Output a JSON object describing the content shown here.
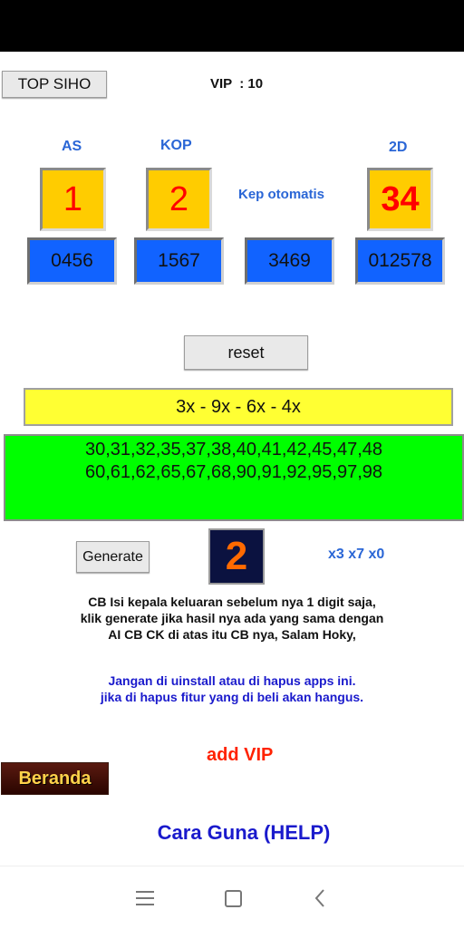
{
  "header": {
    "top_siho_label": "TOP SIHO",
    "vip_text": "VIP  : 10"
  },
  "labels": {
    "as": "AS",
    "kop": "KOP",
    "two_d": "2D",
    "kep": "Kep otomatis"
  },
  "big_digits": {
    "as": "1",
    "kop": "2",
    "two_d": "34"
  },
  "blue_values": [
    "0456",
    "1567",
    "3469",
    "012578"
  ],
  "reset_label": "reset",
  "pattern": "3x - 9x - 6x - 4x",
  "numbers": {
    "line1": "30,31,32,35,37,38,40,41,42,45,47,48",
    "line2": "60,61,62,65,67,68,90,91,92,95,97,98"
  },
  "generate": {
    "label": "Generate",
    "result": "2",
    "multipliers": "x3 x7 x0"
  },
  "info": {
    "line1": "CB Isi kepala keluaran sebelum nya 1 digit saja,",
    "line2": "klik generate jika hasil nya ada yang sama dengan",
    "line3": "AI CB CK di atas itu CB nya, Salam Hoky,"
  },
  "warning": {
    "line1": "Jangan di uinstall atau di hapus apps ini.",
    "line2": "jika di hapus fitur yang di beli akan hangus."
  },
  "add_vip": "add VIP",
  "beranda": "Beranda",
  "help": "Cara Guna (HELP)",
  "colors": {
    "yellow": "#ffcc00",
    "blue_box": "#1163ff",
    "green_panel": "#00ff00",
    "pattern_bar": "#ffff33",
    "red_text": "#ff0000",
    "help_blue": "#1a1acc"
  }
}
